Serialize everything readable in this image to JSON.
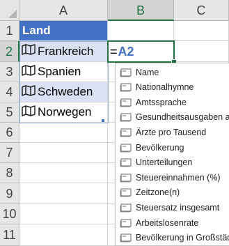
{
  "columns": [
    "A",
    "B",
    "C"
  ],
  "rows": [
    "1",
    "2",
    "3",
    "4",
    "5",
    "6",
    "7",
    "8",
    "9",
    "10",
    "11"
  ],
  "table": {
    "header": "Land",
    "countries": [
      "Frankreich",
      "Spanien",
      "Schweden",
      "Norwegen"
    ]
  },
  "active_cell": {
    "equals": "=",
    "reference": "A2"
  },
  "field_list": [
    "Name",
    "Nationalhymne",
    "Amtssprache",
    "Gesundheitsausgaben als %",
    "Ärzte pro Tausend",
    "Bevölkerung",
    "Unterteilungen",
    "Steuereinnahmen (%)",
    "Zeitzone(n)",
    "Steuersatz insgesamt",
    "Arbeitslosenrate",
    "Bevölkerung in Großstädten"
  ],
  "colors": {
    "header_fill": "#4472c4",
    "band_fill": "#d9e1f2",
    "selection": "#217346"
  },
  "icons": {
    "country": "map-icon",
    "field": "field-card-icon"
  }
}
